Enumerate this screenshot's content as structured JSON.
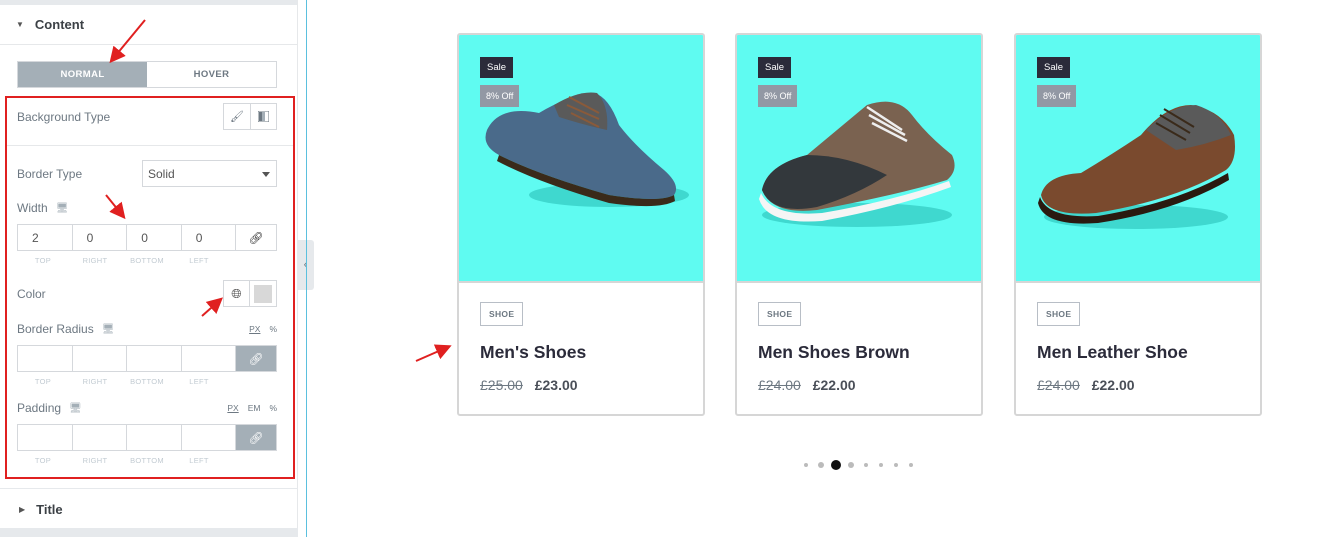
{
  "panel": {
    "content_section": "Content",
    "tabs": [
      {
        "label": "NORMAL"
      },
      {
        "label": "HOVER"
      }
    ],
    "background_type_label": "Background Type",
    "border_type_label": "Border Type",
    "border_type_value": "Solid",
    "width_label": "Width",
    "width_values": [
      "2",
      "0",
      "0",
      "0"
    ],
    "dim_labels": [
      "TOP",
      "RIGHT",
      "BOTTOM",
      "LEFT"
    ],
    "color_label": "Color",
    "border_radius_label": "Border Radius",
    "border_radius_units": [
      "PX",
      "%"
    ],
    "padding_label": "Padding",
    "padding_units": [
      "PX",
      "EM",
      "%"
    ],
    "title_section": "Title"
  },
  "products": [
    {
      "sale": "Sale",
      "off": "8% Off",
      "category": "SHOE",
      "name": "Men's Shoes",
      "old_price": "£25.00",
      "new_price": "£23.00"
    },
    {
      "sale": "Sale",
      "off": "8% Off",
      "category": "SHOE",
      "name": "Men Shoes Brown",
      "old_price": "£24.00",
      "new_price": "£22.00"
    },
    {
      "sale": "Sale",
      "off": "8% Off",
      "category": "SHOE",
      "name": "Men Leather Shoe",
      "old_price": "£24.00",
      "new_price": "£22.00"
    }
  ],
  "carousel": {
    "dot_count": 8,
    "active_index": 2
  },
  "colors": {
    "card_image_bg": "#5ffbf1",
    "annotation_red": "#e02020",
    "active_tab": "#a4afb7"
  }
}
